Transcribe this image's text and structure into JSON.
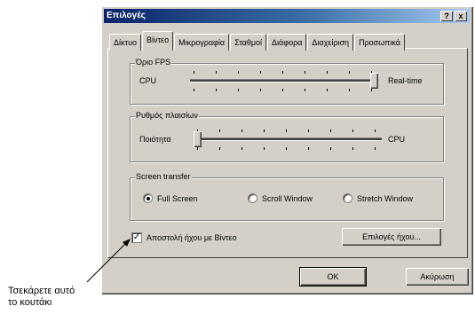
{
  "window": {
    "title": "Επιλογές",
    "help_label": "?",
    "close_label": "x"
  },
  "tabs": [
    {
      "label": "Δίκτυο"
    },
    {
      "label": "Βίντεο",
      "active": true
    },
    {
      "label": "Μικρογραφία"
    },
    {
      "label": "Σταθμοί"
    },
    {
      "label": "Διάφορα"
    },
    {
      "label": "Διαχείριση"
    },
    {
      "label": "Προσωπικά"
    }
  ],
  "fps_group": {
    "label": "Όριο FPS",
    "left_label": "CPU",
    "right_label": "Real-time",
    "slider_value": 1.0
  },
  "frame_rate_group": {
    "label": "Ρυθμός πλαισίων",
    "left_label": "Ποιότητα",
    "right_label": "CPU",
    "slider_value": 0.0
  },
  "screen_transfer": {
    "label": "Screen transfer",
    "options": [
      {
        "label": "Full Screen",
        "selected": true
      },
      {
        "label": "Scroll Window",
        "selected": false
      },
      {
        "label": "Stretch Window",
        "selected": false
      }
    ]
  },
  "send_audio": {
    "label": "Αποστολή ήχου με Βίντεο",
    "checked": true,
    "check_glyph": "✓"
  },
  "audio_options_button": "Επιλογές ήχου...",
  "ok_button": "OK",
  "cancel_button": "Ακύρωση",
  "annotation": {
    "line1": "Τσεκάρετε αυτό",
    "line2": "το κουτάκι"
  }
}
